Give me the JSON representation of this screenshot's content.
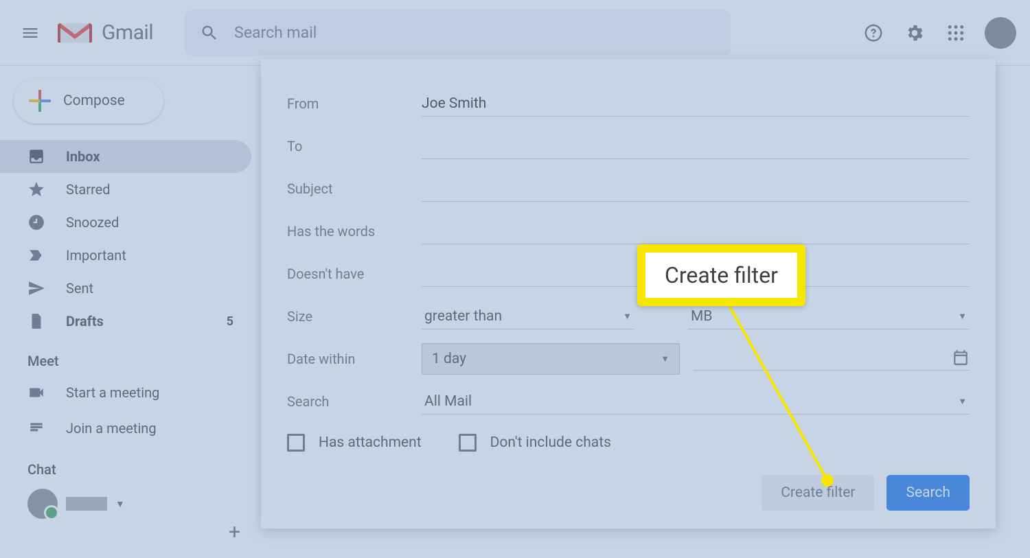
{
  "app": {
    "name": "Gmail"
  },
  "search": {
    "placeholder": "Search mail"
  },
  "compose": {
    "label": "Compose"
  },
  "nav": [
    {
      "id": "inbox",
      "label": "Inbox",
      "active": true,
      "count": ""
    },
    {
      "id": "starred",
      "label": "Starred"
    },
    {
      "id": "snoozed",
      "label": "Snoozed"
    },
    {
      "id": "important",
      "label": "Important"
    },
    {
      "id": "sent",
      "label": "Sent"
    },
    {
      "id": "drafts",
      "label": "Drafts",
      "bold": true,
      "count": "5"
    }
  ],
  "meet": {
    "header": "Meet",
    "start": "Start a meeting",
    "join": "Join a meeting"
  },
  "chat": {
    "header": "Chat"
  },
  "filter": {
    "from_label": "From",
    "from_value": "Joe Smith",
    "to_label": "To",
    "to_value": "",
    "subject_label": "Subject",
    "subject_value": "",
    "haswords_label": "Has the words",
    "haswords_value": "",
    "nothave_label": "Doesn't have",
    "nothave_value": "",
    "size_label": "Size",
    "size_op": "greater than",
    "size_unit": "MB",
    "date_label": "Date within",
    "date_range": "1 day",
    "search_label": "Search",
    "search_scope": "All Mail",
    "has_attachment": "Has attachment",
    "exclude_chats": "Don't include chats",
    "create": "Create filter",
    "search_btn": "Search"
  },
  "callout": {
    "text": "Create filter"
  }
}
